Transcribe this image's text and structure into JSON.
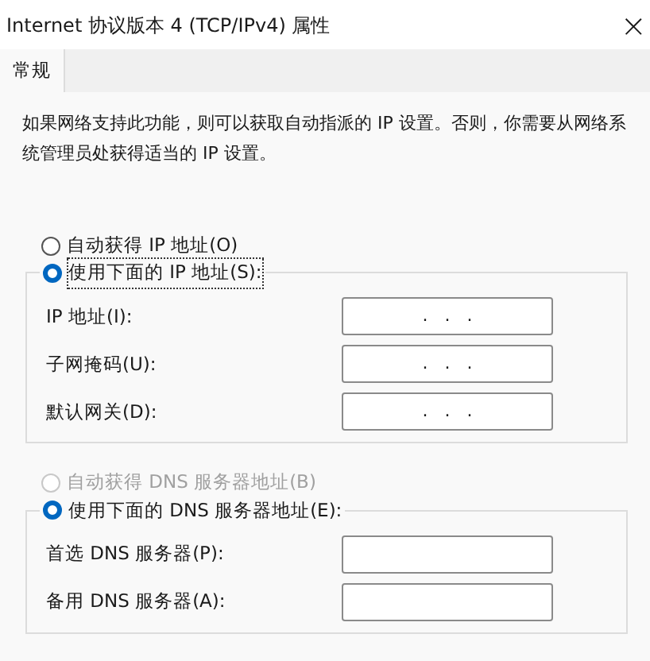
{
  "window": {
    "title": "Internet 协议版本 4 (TCP/IPv4) 属性",
    "close": "×"
  },
  "tabs": [
    {
      "label": "常规",
      "selected": true
    }
  ],
  "description": "如果网络支持此功能，则可以获取自动指派的 IP 设置。否则，你需要从网络系统管理员处获得适当的 IP 设置。",
  "sections": [
    {
      "auto": {
        "label": "自动获得 IP 地址(O)",
        "selected": false,
        "disabled": false
      },
      "manual": {
        "label": "使用下面的 IP 地址(S):",
        "selected": true,
        "focused": true
      },
      "fields": [
        {
          "label": "IP 地址(I):",
          "value": ".   .   ."
        },
        {
          "label": "子网掩码(U):",
          "value": ".   .   ."
        },
        {
          "label": "默认网关(D):",
          "value": ".   .   ."
        }
      ]
    },
    {
      "auto": {
        "label": "自动获得 DNS 服务器地址(B)",
        "selected": false,
        "disabled": true
      },
      "manual": {
        "label": "使用下面的 DNS 服务器地址(E):",
        "selected": true,
        "focused": false
      },
      "fields": [
        {
          "label": "首选 DNS 服务器(P):"
        },
        {
          "label": "备用 DNS 服务器(A):"
        }
      ]
    }
  ]
}
